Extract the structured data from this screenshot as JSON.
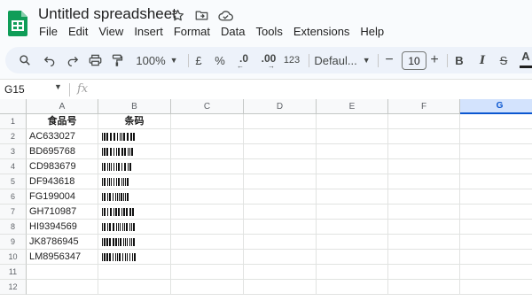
{
  "app": {
    "title": "Untitled spreadsheet",
    "logo_icon": "sheets-logo-icon",
    "brand_color": "#0f9d58"
  },
  "title_icons": [
    "star-icon",
    "move-to-folder-icon",
    "cloud-status-icon"
  ],
  "menu": [
    "File",
    "Edit",
    "View",
    "Insert",
    "Format",
    "Data",
    "Tools",
    "Extensions",
    "Help"
  ],
  "toolbar": {
    "search_icon": "search-icon",
    "undo_icon": "undo-icon",
    "redo_icon": "redo-icon",
    "print_icon": "print-icon",
    "paint_format_icon": "paint-format-icon",
    "zoom": "100%",
    "currency": "£",
    "percent": "%",
    "decrease_decimal": ".0",
    "increase_decimal": ".00",
    "number_format": "123",
    "font": "Defaul...",
    "minus": "−",
    "font_size": "10",
    "plus": "+",
    "bold": "B",
    "italic": "I",
    "strikethrough": "S",
    "text_color": "A"
  },
  "formula_bar": {
    "name_box": "G15",
    "fx_label": "fx",
    "value": ""
  },
  "sheet": {
    "columns": [
      "A",
      "B",
      "C",
      "D",
      "E",
      "F",
      "G"
    ],
    "selected_column": "G",
    "row_numbers": [
      "1",
      "2",
      "3",
      "4",
      "5",
      "6",
      "7",
      "8",
      "9",
      "10",
      "11",
      "12"
    ],
    "headers": {
      "a": "食品号",
      "b": "条码"
    },
    "rows": [
      {
        "code": "AC633027",
        "barcode_digits": "633027"
      },
      {
        "code": "BD695768",
        "barcode_digits": "695768"
      },
      {
        "code": "CD983679",
        "barcode_digits": "983679"
      },
      {
        "code": "DF943618",
        "barcode_digits": "943618"
      },
      {
        "code": "FG199004",
        "barcode_digits": "199004"
      },
      {
        "code": "GH710987",
        "barcode_digits": "710987"
      },
      {
        "code": "HI9394569",
        "barcode_digits": "9394569"
      },
      {
        "code": "JK8786945",
        "barcode_digits": "8786945"
      },
      {
        "code": "LM8956347",
        "barcode_digits": "8956347"
      }
    ]
  }
}
